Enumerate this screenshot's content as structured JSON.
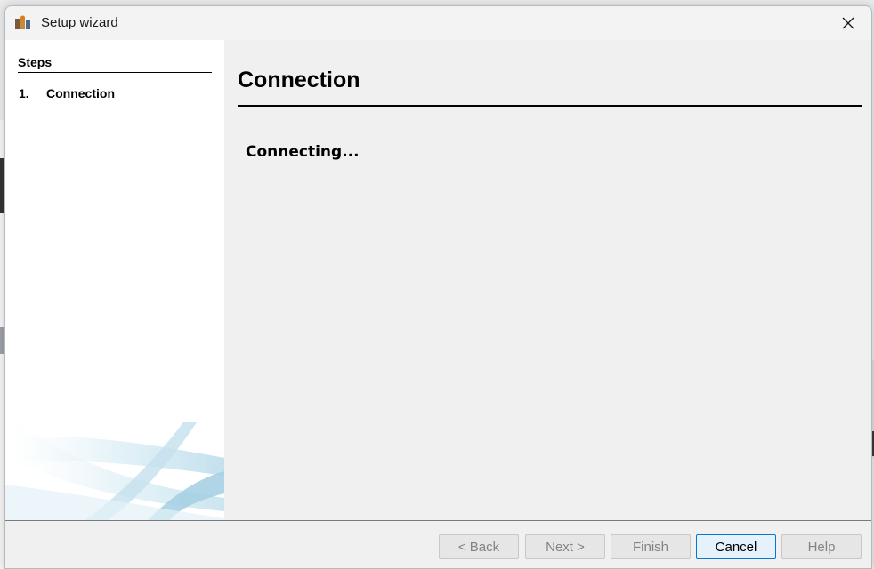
{
  "window": {
    "title": "Setup wizard",
    "icon": "app-logo-icon",
    "close_icon": "close-icon"
  },
  "steps": {
    "title": "Steps",
    "items": [
      {
        "number": "1.",
        "label": "Connection"
      }
    ]
  },
  "content": {
    "title": "Connection",
    "status": "Connecting..."
  },
  "footer": {
    "back_label": "< Back",
    "next_label": "Next >",
    "finish_label": "Finish",
    "cancel_label": "Cancel",
    "help_label": "Help"
  },
  "colors": {
    "accent": "#0078d7",
    "swoosh": "#a8d4e6"
  }
}
